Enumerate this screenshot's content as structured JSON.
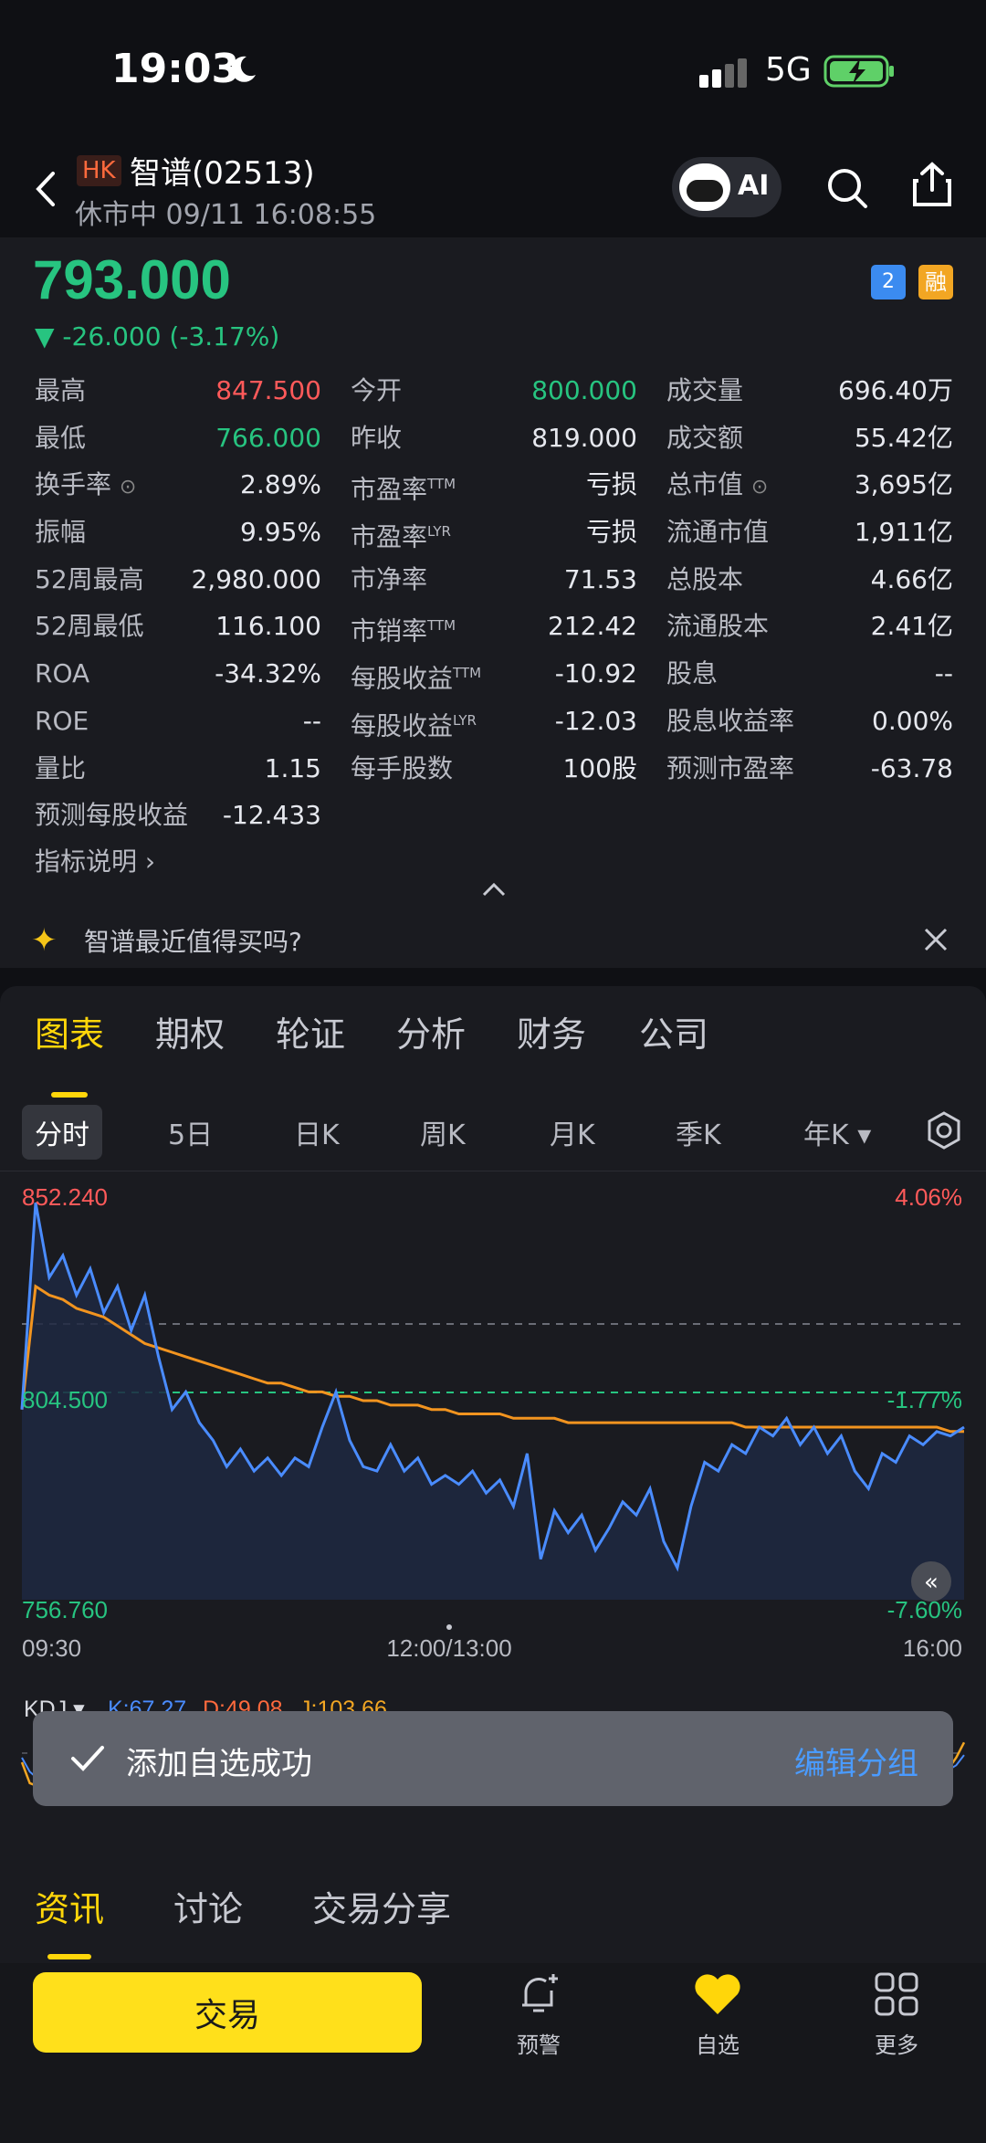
{
  "status_bar": {
    "time": "19:03",
    "network": "5G"
  },
  "header": {
    "market_badge": "HK",
    "stock_name": "智谱(02513)",
    "market_status": "休市中 09/11 16:08:55",
    "ai_label": "AI"
  },
  "quote": {
    "price": "793.000",
    "change": "▼ -26.000 (-3.17%)",
    "badge_level": "2",
    "badge_margin": "融",
    "rows": [
      [
        {
          "label": "最高",
          "value": "847.500"
        },
        {
          "label": "今开",
          "value": "800.000"
        },
        {
          "label": "成交量",
          "value": "696.40万"
        }
      ],
      [
        {
          "label": "最低",
          "value": "766.000"
        },
        {
          "label": "昨收",
          "value": "819.000"
        },
        {
          "label": "成交额",
          "value": "55.42亿"
        }
      ],
      [
        {
          "label": "换手率",
          "value": "2.89%"
        },
        {
          "label": "市盈率",
          "value": "亏损",
          "sup": "TTM"
        },
        {
          "label": "总市值",
          "value": "3,695亿"
        }
      ],
      [
        {
          "label": "振幅",
          "value": "9.95%"
        },
        {
          "label": "市盈率",
          "value": "亏损",
          "sup": "LYR"
        },
        {
          "label": "流通市值",
          "value": "1,911亿"
        }
      ],
      [
        {
          "label": "52周最高",
          "value": "2,980.000"
        },
        {
          "label": "市净率",
          "value": "71.53"
        },
        {
          "label": "总股本",
          "value": "4.66亿"
        }
      ],
      [
        {
          "label": "52周最低",
          "value": "116.100"
        },
        {
          "label": "市销率",
          "value": "212.42",
          "sup": "TTM"
        },
        {
          "label": "流通股本",
          "value": "2.41亿"
        }
      ],
      [
        {
          "label": "ROA",
          "value": "-34.32%"
        },
        {
          "label": "每股收益",
          "value": "-10.92",
          "sup": "TTM"
        },
        {
          "label": "股息",
          "value": "--"
        }
      ],
      [
        {
          "label": "ROE",
          "value": "--"
        },
        {
          "label": "每股收益",
          "value": "-12.03",
          "sup": "LYR"
        },
        {
          "label": "股息收益率",
          "value": "0.00%"
        }
      ],
      [
        {
          "label": "量比",
          "value": "1.15"
        },
        {
          "label": "每手股数",
          "value": "100股"
        },
        {
          "label": "预测市盈率",
          "value": "-63.78"
        }
      ],
      [
        {
          "label": "预测每股收益",
          "value": "-12.433"
        }
      ]
    ],
    "indicator_link": "指标说明 ›",
    "ai_question": "智谱最近值得买吗?"
  },
  "tabs": [
    "图表",
    "期权",
    "轮证",
    "分析",
    "财务",
    "公司"
  ],
  "periods": [
    "分时",
    "5日",
    "日K",
    "周K",
    "月K",
    "季K",
    "年K ▾"
  ],
  "chart": {
    "price_high": "852.240",
    "price_mid": "804.500",
    "price_low": "756.760",
    "pct_high": "4.06%",
    "pct_mid": "-1.77%",
    "pct_low": "-7.60%",
    "time_start": "09:30",
    "time_mid": "12:00/13:00",
    "time_end": "16:00"
  },
  "chart_data": {
    "type": "line",
    "y_range": [
      756.76,
      852.24
    ],
    "prev_close": 819.0,
    "x_labels": [
      "09:30",
      "12:00/13:00",
      "16:00"
    ],
    "series": [
      {
        "color": "#4a8cff",
        "values": [
          800,
          847,
          830,
          835,
          826,
          832,
          822,
          828,
          818,
          826,
          812,
          800,
          804,
          797,
          793,
          787,
          791,
          786,
          789,
          785,
          789,
          787,
          796,
          804,
          793,
          787,
          786,
          792,
          786,
          789,
          783,
          785,
          783,
          786,
          781,
          784,
          778,
          790,
          766,
          777,
          772,
          776,
          768,
          773,
          779,
          776,
          782,
          770,
          764,
          778,
          788,
          786,
          792,
          790,
          796,
          794,
          798,
          792,
          796,
          790,
          794,
          786,
          782,
          790,
          788,
          794,
          792,
          795,
          794,
          796
        ]
      },
      {
        "color": "#f2941f",
        "values": [
          800,
          828,
          826,
          825,
          823,
          822,
          821,
          819,
          817,
          815,
          814,
          813,
          812,
          811,
          810,
          809,
          808,
          807,
          806,
          806,
          805,
          804,
          804,
          803,
          803,
          802,
          802,
          801,
          801,
          801,
          800,
          800,
          799,
          799,
          799,
          799,
          798,
          798,
          798,
          798,
          797,
          797,
          797,
          797,
          797,
          797,
          797,
          797,
          797,
          797,
          797,
          797,
          797,
          796,
          796,
          796,
          796,
          796,
          796,
          796,
          796,
          796,
          796,
          796,
          796,
          796,
          796,
          796,
          795,
          795
        ]
      }
    ]
  },
  "kdj": {
    "name": "KDJ ▾",
    "k": "K:67.27",
    "d": "D:49.08",
    "j": "J:103.66"
  },
  "toast": {
    "text": "添加自选成功",
    "action": "编辑分组"
  },
  "bottom_tabs": [
    "资讯",
    "讨论",
    "交易分享"
  ],
  "bottom_bar": {
    "trade": "交易",
    "alert": "预警",
    "watchlist": "自选",
    "more": "更多"
  },
  "colors": {
    "accent": "#ffd60a",
    "up": "#ff5a5a",
    "down": "#27c480",
    "price_line": "#4a8cff",
    "avg_line": "#f2941f"
  }
}
